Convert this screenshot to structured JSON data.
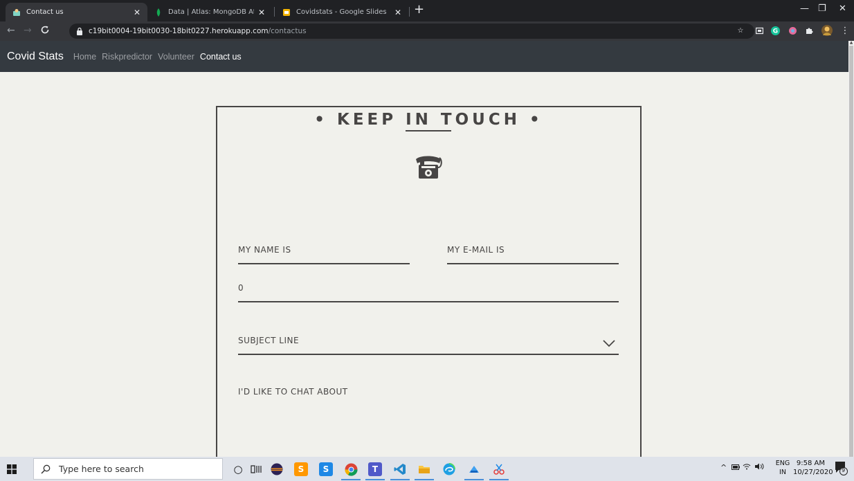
{
  "browser": {
    "tabs": [
      {
        "title": "Contact us",
        "active": true
      },
      {
        "title": "Data | Atlas: MongoDB Atlas",
        "active": false
      },
      {
        "title": "Covidstats - Google Slides",
        "active": false
      }
    ],
    "url_host": "c19bit0004-19bit0030-18bit0227.herokuapp.com",
    "url_path": "/contactus"
  },
  "site_nav": {
    "brand": "Covid Stats",
    "links": [
      {
        "label": "Home",
        "active": false
      },
      {
        "label": "Riskpredictor",
        "active": false
      },
      {
        "label": "Volunteer",
        "active": false
      },
      {
        "label": "Contact us",
        "active": true
      }
    ]
  },
  "form": {
    "heading": "• KEEP IN TOUCH •",
    "name_label": "MY NAME IS",
    "email_label": "MY E-MAIL IS",
    "number_value": "0",
    "subject_label": "SUBJECT LINE",
    "message_label": "I'D LIKE TO CHAT ABOUT"
  },
  "taskbar": {
    "search_placeholder": "Type here to search",
    "lang_top": "ENG",
    "lang_bottom": "IN",
    "time": "9:58 AM",
    "date": "10/27/2020",
    "notification_count": "9"
  },
  "colors": {
    "page_bg": "#f1f1ec",
    "form_ink": "#474544",
    "navbar_bg": "#343a40"
  }
}
